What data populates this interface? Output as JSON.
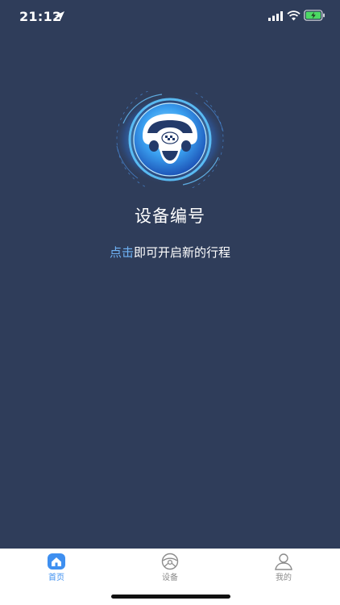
{
  "status_bar": {
    "time": "21:12",
    "icons": [
      "location-arrow-icon",
      "cellular-signal-icon",
      "wifi-icon",
      "battery-charging-icon"
    ]
  },
  "main": {
    "emblem_icon": "steering-wheel-taxi-icon",
    "device_title": "设备编号",
    "hint_link": "点击",
    "hint_text": "即可开启新的行程"
  },
  "tabs": [
    {
      "label": "首页",
      "icon": "home-icon",
      "active": true
    },
    {
      "label": "设备",
      "icon": "steering-wheel-icon",
      "active": false
    },
    {
      "label": "我的",
      "icon": "user-icon",
      "active": false
    }
  ],
  "colors": {
    "background": "#2f3d5a",
    "accent": "#3e8ff0",
    "link": "#6fb2f5",
    "tab_inactive": "#8c8c8c"
  }
}
